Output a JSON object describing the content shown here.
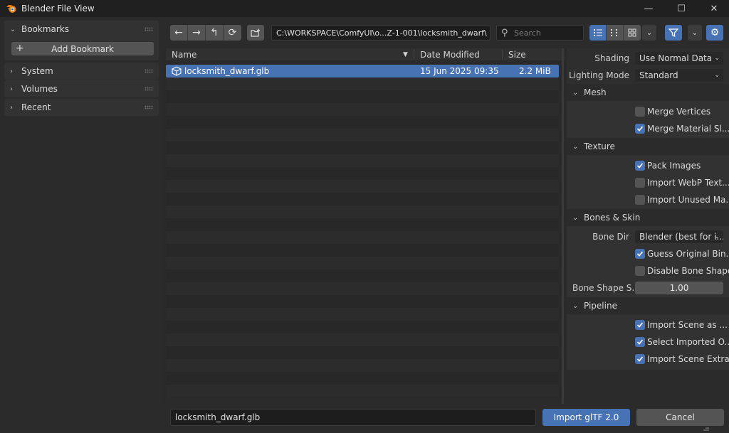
{
  "window": {
    "title": "Blender File View",
    "controls": {
      "minimize": "—",
      "maximize": "☐",
      "close": "✕"
    }
  },
  "sidebar": {
    "bookmarks": {
      "label": "Bookmarks",
      "add_label": "Add Bookmark"
    },
    "system": {
      "label": "System"
    },
    "volumes": {
      "label": "Volumes"
    },
    "recent": {
      "label": "Recent"
    }
  },
  "toolbar": {
    "path": "C:\\WORKSPACE\\ComfyUI\\o...Z-1-001\\locksmith_dwarf\\",
    "search_placeholder": "Search"
  },
  "filelist": {
    "columns": {
      "name": "Name",
      "date": "Date Modified",
      "size": "Size"
    },
    "files": [
      {
        "name": "locksmith_dwarf.glb",
        "date": "15 Jun 2025 09:35",
        "size": "2.2 MiB",
        "selected": true
      }
    ]
  },
  "options": {
    "shading": {
      "label": "Shading",
      "value": "Use Normal Data"
    },
    "lighting": {
      "label": "Lighting Mode",
      "value": "Standard"
    },
    "mesh": {
      "title": "Mesh",
      "merge_vertices": {
        "label": "Merge Vertices",
        "checked": false
      },
      "merge_material": {
        "label": "Merge Material Sl...",
        "checked": true
      }
    },
    "texture": {
      "title": "Texture",
      "pack_images": {
        "label": "Pack Images",
        "checked": true
      },
      "import_webp": {
        "label": "Import WebP Text...",
        "checked": false
      },
      "import_unused": {
        "label": "Import Unused Ma...",
        "checked": false
      }
    },
    "bones": {
      "title": "Bones & Skin",
      "bone_dir": {
        "label": "Bone Dir",
        "value": "Blender (best for i..."
      },
      "guess_bind": {
        "label": "Guess Original Bin...",
        "checked": true
      },
      "disable_shape": {
        "label": "Disable Bone Shape",
        "checked": false
      },
      "bone_shape_scale": {
        "label": "Bone Shape S...",
        "value": "1.00"
      }
    },
    "pipeline": {
      "title": "Pipeline",
      "import_scene": {
        "label": "Import Scene as ...",
        "checked": true
      },
      "select_imported": {
        "label": "Select Imported O...",
        "checked": true
      },
      "scene_extras": {
        "label": "Import Scene Extras",
        "checked": true
      }
    }
  },
  "footer": {
    "filename": "locksmith_dwarf.glb",
    "import_label": "Import glTF 2.0",
    "cancel_label": "Cancel"
  },
  "colors": {
    "accent": "#4772b3",
    "background": "#2b2b2b",
    "panel": "#323232",
    "button": "#545454"
  }
}
